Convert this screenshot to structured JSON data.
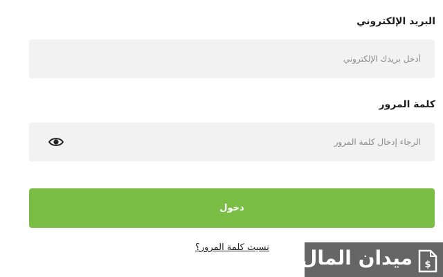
{
  "form": {
    "email_label": "البريد الإلكتروني",
    "email_placeholder": "أدخل بريدك الإلكتروني",
    "password_label": "كلمة المرور",
    "password_placeholder": "الرجاء إدخال كلمة المرور",
    "show_password_icon": "eye-icon",
    "login_label": "دخول",
    "forgot_password": "نسيت كلمة المرور؟"
  },
  "brand": {
    "name": "ميدان المال",
    "icon": "money-document-icon",
    "accent": "#79bd45",
    "logo_bg": "#666666"
  }
}
